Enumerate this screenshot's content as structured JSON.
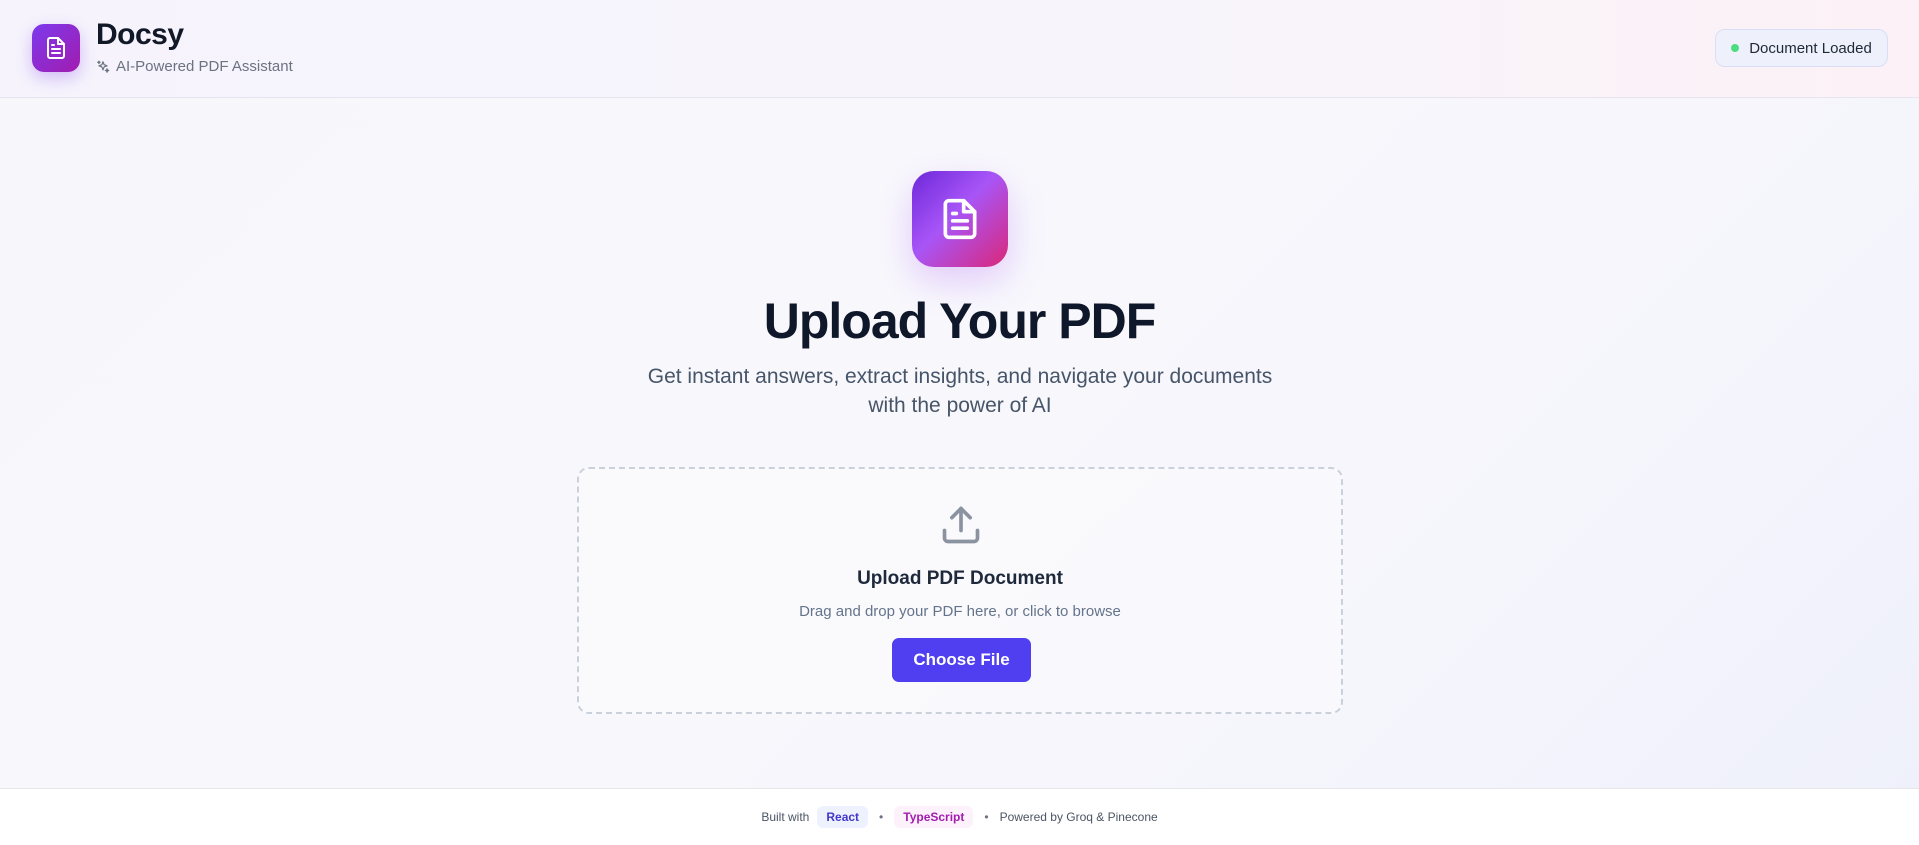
{
  "header": {
    "app_name": "Docsy",
    "tagline": "AI-Powered PDF Assistant",
    "status_label": "Document Loaded",
    "status_color": "#4ade80"
  },
  "hero": {
    "title": "Upload Your PDF",
    "description_line1": "Get instant answers, extract insights, and navigate your documents",
    "description_line2": "with the power of AI"
  },
  "upload": {
    "title": "Upload PDF Document",
    "subtitle": "Drag and drop your PDF here, or click to browse",
    "button_label": "Choose File"
  },
  "footer": {
    "built_with": "Built with",
    "tech": [
      "React",
      "TypeScript"
    ],
    "separator": "•",
    "powered_by": "Powered by Groq & Pinecone"
  },
  "colors": {
    "accent": "#4f3ff0",
    "brand_gradient_start": "#7c3aed",
    "brand_gradient_end": "#db2777"
  },
  "icons": {
    "logo": "file-text-icon",
    "tagline": "sparkles-icon",
    "hero": "file-text-icon",
    "upload": "upload-icon"
  }
}
